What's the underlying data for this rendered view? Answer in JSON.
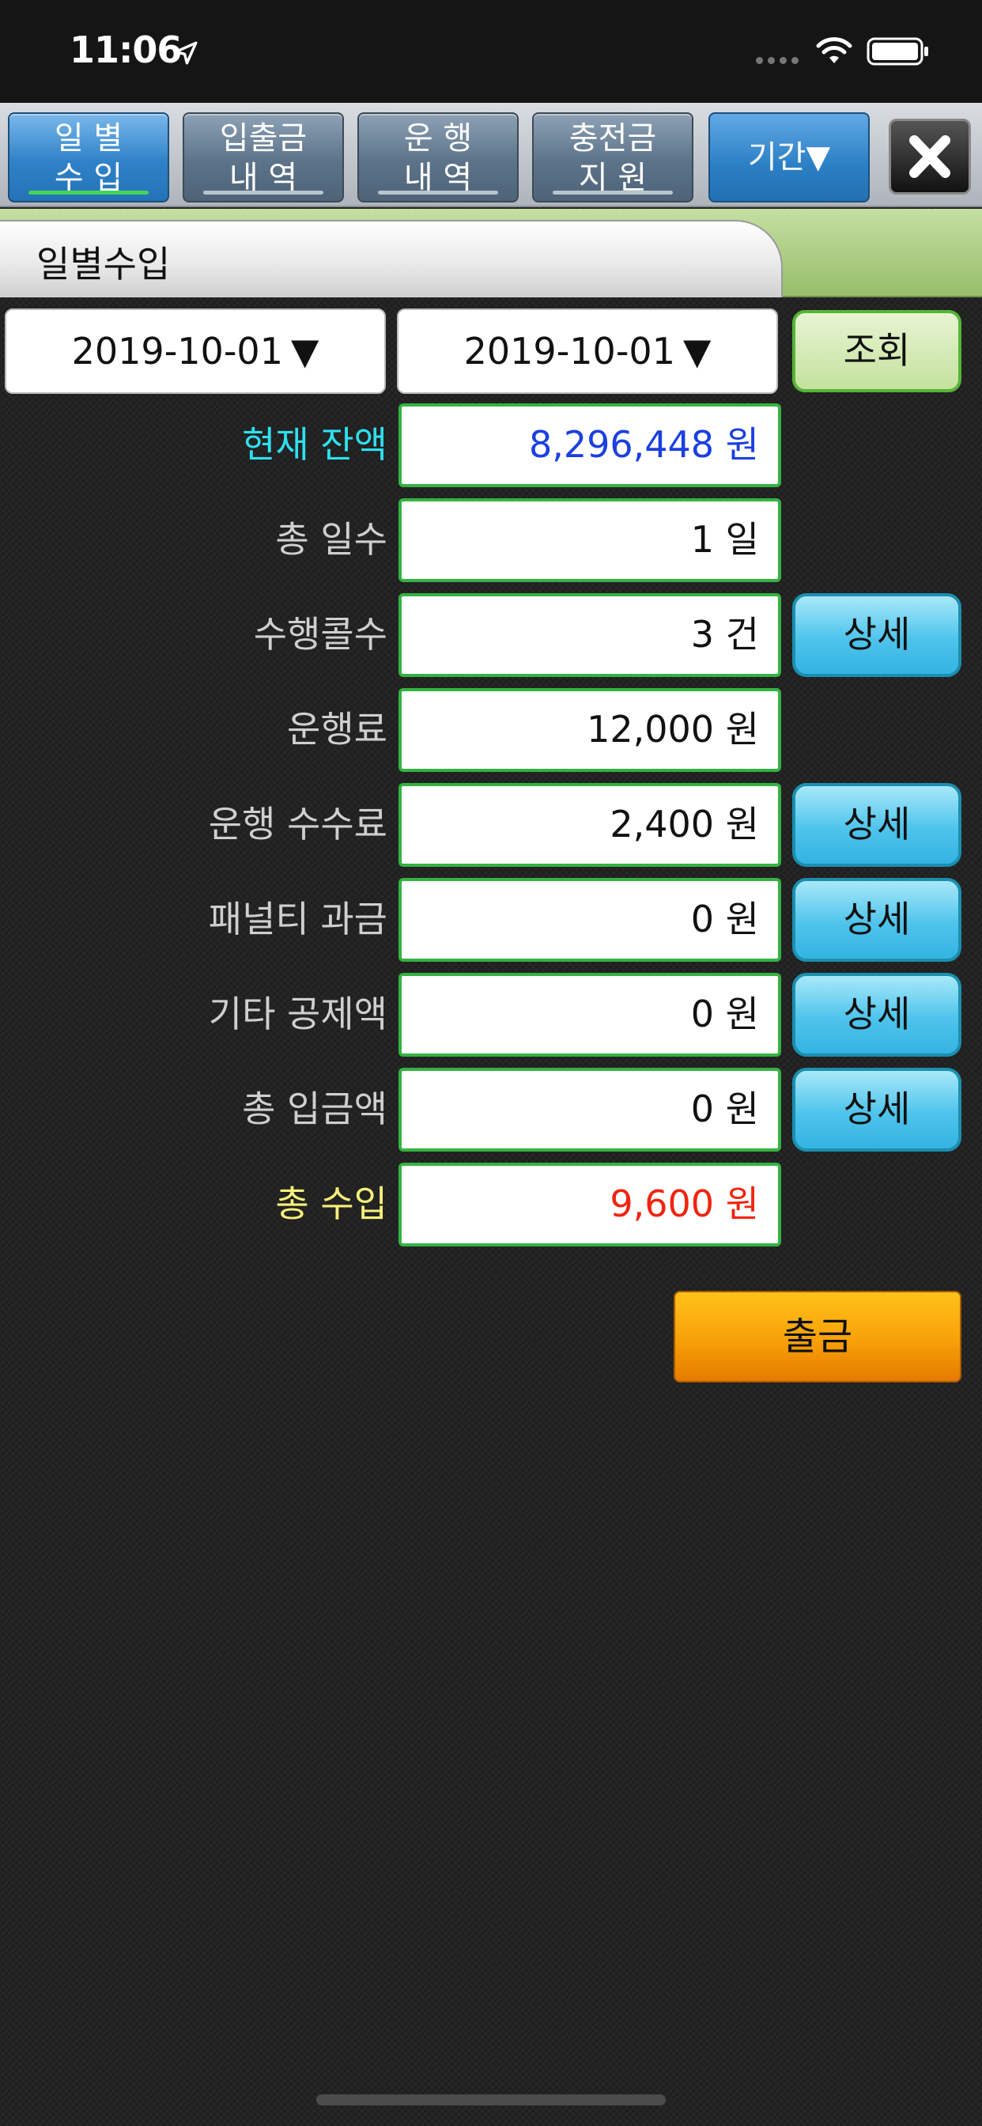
{
  "status_bar": {
    "time": "11:06",
    "icons": [
      "location-arrow-icon",
      "signal-dots-icon",
      "wifi-icon",
      "battery-icon"
    ]
  },
  "tabs": [
    {
      "line1": "일 별",
      "line2": "수 입",
      "active": true
    },
    {
      "line1": "입출금",
      "line2": "내 역",
      "active": false
    },
    {
      "line1": "운 행",
      "line2": "내 역",
      "active": false
    },
    {
      "line1": "충전금",
      "line2": "지 원",
      "active": false
    }
  ],
  "period_button": "기간▼",
  "close_icon": "close-x-icon",
  "section_title": "일별수입",
  "date_range": {
    "start": "2019-10-01",
    "end": "2019-10-01",
    "arrow": "▼"
  },
  "search_button": "조회",
  "rows": [
    {
      "label": "현재 잔액",
      "value": "8,296,448 원",
      "detail": ""
    },
    {
      "label": "총 일수",
      "value": "1 일",
      "detail": ""
    },
    {
      "label": "수행콜수",
      "value": "3 건",
      "detail": "상세"
    },
    {
      "label": "운행료",
      "value": "12,000 원",
      "detail": ""
    },
    {
      "label": "운행 수수료",
      "value": "2,400 원",
      "detail": "상세"
    },
    {
      "label": "패널티 과금",
      "value": "0 원",
      "detail": "상세"
    },
    {
      "label": "기타 공제액",
      "value": "0 원",
      "detail": "상세"
    },
    {
      "label": "총 입금액",
      "value": "0 원",
      "detail": "상세"
    },
    {
      "label": "총 수입",
      "value": "9,600 원",
      "detail": ""
    }
  ],
  "withdraw_button": "출금",
  "colors": {
    "balance_label": "#2ee0ef",
    "balance_value": "#1b3fe0",
    "total_label": "#f6f07a",
    "total_value": "#f02410",
    "active_tab": "#2f82c8",
    "withdraw": "#f8a008"
  }
}
